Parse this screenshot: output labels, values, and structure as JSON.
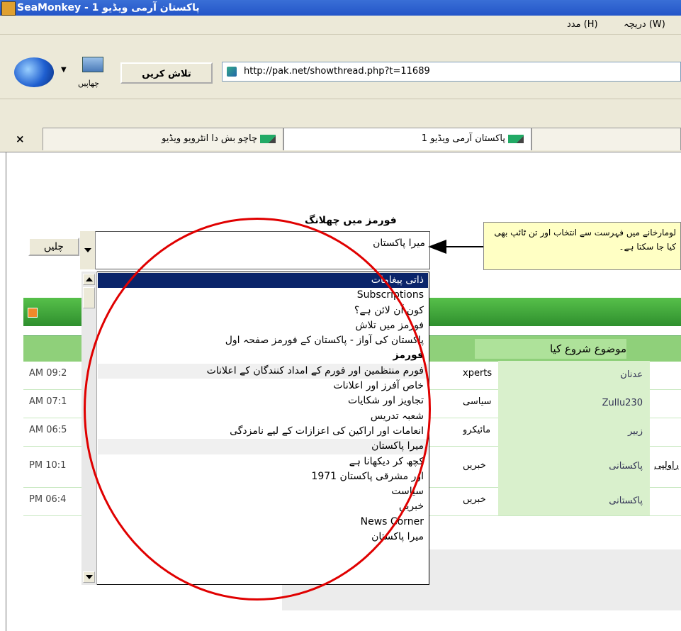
{
  "window": {
    "title": "SeaMonkey - پاکستان آرمی ویڈیو 1"
  },
  "menu": {
    "items": [
      "دریچہ (W)",
      "مدد (H)"
    ]
  },
  "toolbar": {
    "print_label": "چھاپیں",
    "search_label": "تلاش کریں",
    "url": "http://pak.net/showthread.php?t=11689"
  },
  "tabs": {
    "close_label": "×",
    "items": [
      "چاچو بش دا انٹرویو ویڈیو",
      "پاکستان آرمی ویڈیو 1"
    ]
  },
  "forum_jump": {
    "label": "فورمز میں چھلانگ",
    "go_label": "چلیں",
    "selected": "میرا پاکستان",
    "note": "لومارخانے میں فہرست سے انتخاب اور تن ٹائپ بھی کیا جا سکتا ہے۔"
  },
  "dropdown": {
    "items": [
      "ذاتی پیغامات",
      "Subscriptions",
      "کون آن لائن ہے؟",
      "فورمز میں تلاش",
      "پاکستان کی آواز - پاکستان کے فورمز صفحہ اول",
      "فورمز",
      "فورم منتظمین اور فورم کے امداد کنندگان کے اعلانات",
      "خاص آفرز اور اعلانات",
      "تجاویز اور شکایات",
      "شعبہ تدریس",
      "انعامات اور اراکین کی اعزازات کے لیے نامزدگی",
      "میرا پاکستان",
      "کچھ کر دیکھانا ہے",
      "1971 اور مشرقی پاکستان",
      "سیاست",
      "خبریں",
      "News Corner",
      "میرا پاکستان"
    ]
  },
  "forum_table": {
    "column_header": "موضوع شروع کیا",
    "rows": [
      {
        "time": "AM 09:2",
        "category": "xperts",
        "starter": "عدنان",
        "extra": ""
      },
      {
        "time": "AM 07:1",
        "category": "سیاسی",
        "starter": "Zullu230",
        "extra": ""
      },
      {
        "time": "AM 06:5",
        "category": "مائیکرو",
        "starter": "زبیر",
        "extra": ""
      },
      {
        "time": "PM 10:1",
        "category": "خبریں",
        "starter": "پاکستانی",
        "extra": "راولپی"
      },
      {
        "time": "PM 06:4",
        "category": "خبریں",
        "starter": "پاکستانی",
        "extra": ""
      }
    ]
  },
  "colors": {
    "titlebar": "#2455c8",
    "forum_green": "#2e8f2e",
    "highlight": "#0a246a",
    "annotation": "#e00000"
  }
}
